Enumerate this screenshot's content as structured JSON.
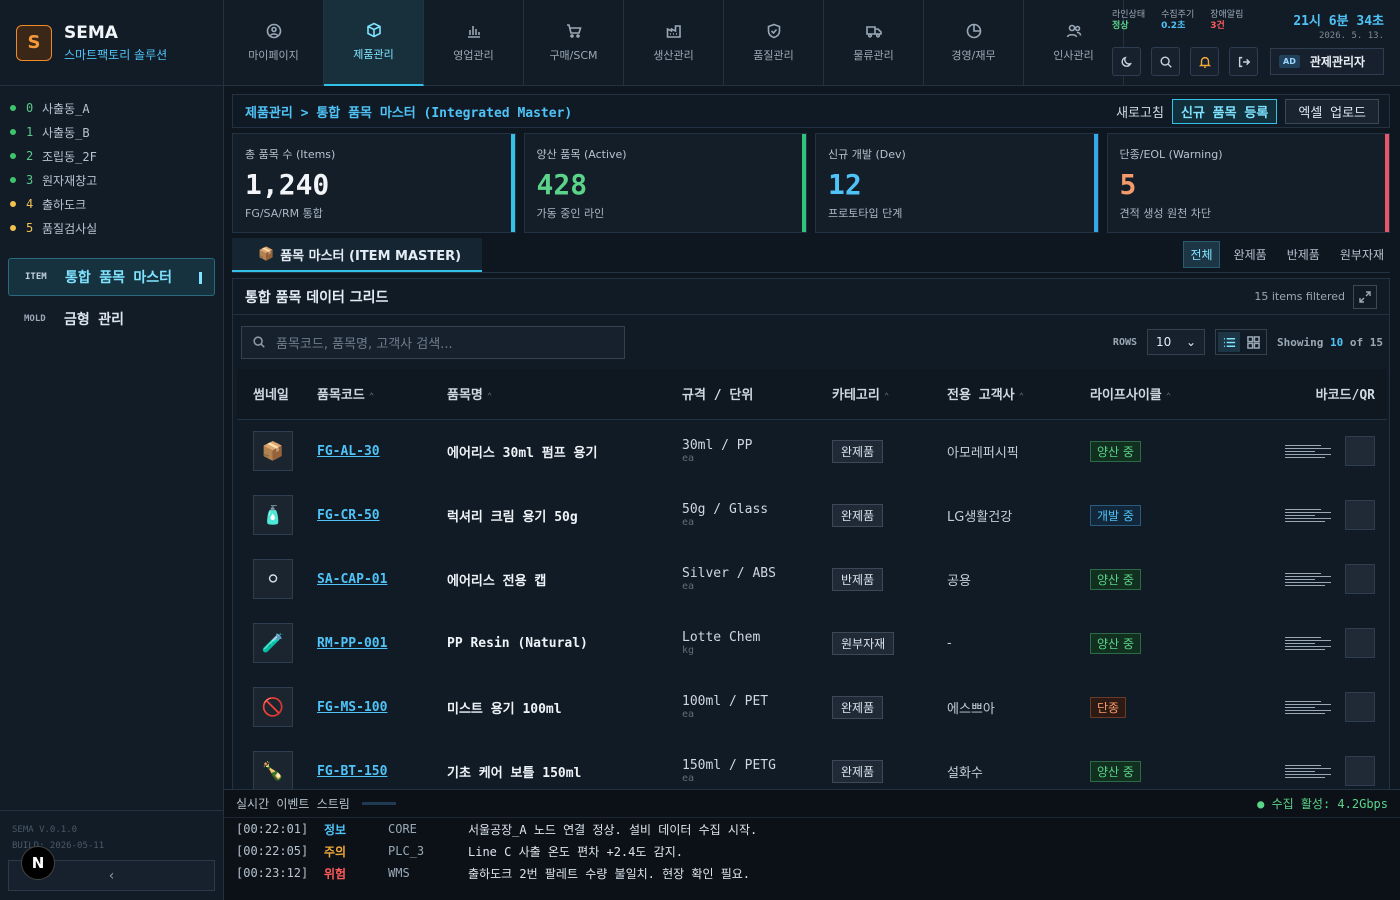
{
  "brand": {
    "logo": "S",
    "name": "SEMA",
    "subtitle": "스마트팩토리 솔루션"
  },
  "zones": [
    {
      "num": "0",
      "label": "사출동_A",
      "color": "#3ec46d",
      "warn": false
    },
    {
      "num": "1",
      "label": "사출동_B",
      "color": "#3ec46d",
      "warn": false
    },
    {
      "num": "2",
      "label": "조립동_2F",
      "color": "#3ec46d",
      "warn": false
    },
    {
      "num": "3",
      "label": "원자재창고",
      "color": "#3ec46d",
      "warn": false
    },
    {
      "num": "4",
      "label": "출하도크",
      "color": "#f2c14e",
      "warn": true
    },
    {
      "num": "5",
      "label": "품질검사실",
      "color": "#f2c14e",
      "warn": true
    }
  ],
  "sidenav": [
    {
      "code": "ITEM",
      "label": "통합 품목 마스터",
      "active": true
    },
    {
      "code": "MOLD",
      "label": "금형 관리",
      "active": false
    }
  ],
  "version": {
    "line1": "SEMA V.0.1.0",
    "line2": "BUILD: 2026-05-11"
  },
  "nbadge": "N",
  "collapse": "‹",
  "tabs": [
    {
      "label": "마이페이지",
      "icon": "user-icon"
    },
    {
      "label": "제품관리",
      "icon": "cube-icon",
      "active": true
    },
    {
      "label": "영업관리",
      "icon": "bar-chart-icon"
    },
    {
      "label": "구매/SCM",
      "icon": "cart-icon"
    },
    {
      "label": "생산관리",
      "icon": "factory-icon"
    },
    {
      "label": "품질관리",
      "icon": "shield-icon"
    },
    {
      "label": "물류관리",
      "icon": "truck-icon"
    },
    {
      "label": "경영/재무",
      "icon": "pie-icon"
    },
    {
      "label": "인사관리",
      "icon": "people-icon"
    }
  ],
  "status": {
    "line_label": "라인상태",
    "line_value": "정상",
    "line_color": "#5bd48a",
    "cycle_label": "수집주기",
    "cycle_value": "0.2초",
    "cycle_color": "#4fc3f7",
    "alarm_label": "장애알림",
    "alarm_value": "3건",
    "alarm_color": "#ff5a5a"
  },
  "clock": {
    "time": "21시 6분 34초",
    "date": "2026. 5. 13."
  },
  "user": {
    "badge": "AD",
    "name": "관제관리자"
  },
  "breadcrumb": "제품관리 > 통합 품목 마스터 (Integrated Master)",
  "actions": {
    "refresh": "새로고침",
    "new": "신규 품목 등록",
    "excel": "엑셀 업로드"
  },
  "kpis": [
    {
      "label": "총 품목 수 (Items)",
      "value": "1,240",
      "sub": "FG/SA/RM 통합",
      "color": "#f2f5f8",
      "edge": "#33c1e8"
    },
    {
      "label": "양산 품목 (Active)",
      "value": "428",
      "sub": "가동 중인 라인",
      "color": "#5bd48a",
      "edge": "#2fc47a"
    },
    {
      "label": "신규 개발 (Dev)",
      "value": "12",
      "sub": "프로토타입 단계",
      "color": "#4fc3f7",
      "edge": "#33a9e8"
    },
    {
      "label": "단종/EOL (Warning)",
      "value": "5",
      "sub": "견적 생성 원천 차단",
      "color": "#f59a6a",
      "edge": "#e8566a"
    }
  ],
  "section_tab": "품목 마스터 (ITEM MASTER)",
  "filters": [
    {
      "label": "전체",
      "active": true
    },
    {
      "label": "완제품"
    },
    {
      "label": "반제품"
    },
    {
      "label": "원부자재"
    }
  ],
  "grid": {
    "title": "통합 품목 데이터 그리드",
    "filtered": "15 items filtered",
    "search_placeholder": "품목코드, 품목명, 고객사 검색...",
    "rows_label": "ROWS",
    "rows_value": "10",
    "showing_prefix": "Showing",
    "showing_count": "10",
    "showing_mid": "of",
    "showing_total": "15",
    "columns": [
      "썸네일",
      "품목코드",
      "품목명",
      "규격 / 단위",
      "카테고리",
      "전용 고객사",
      "라이프사이클",
      "바코드/QR"
    ],
    "rows": [
      {
        "thumb": "📦",
        "code": "FG-AL-30",
        "name": "에어리스 30ml 펌프 용기",
        "spec": "30ml / PP",
        "unit": "ea",
        "category": "완제품",
        "customer": "아모레퍼시픽",
        "life": "양산 중",
        "life_type": "mass"
      },
      {
        "thumb": "🧴",
        "code": "FG-CR-50",
        "name": "럭셔리 크림 용기 50g",
        "spec": "50g / Glass",
        "unit": "ea",
        "category": "완제품",
        "customer": "LG생활건강",
        "life": "개발 중",
        "life_type": "dev"
      },
      {
        "thumb": "⚪",
        "code": "SA-CAP-01",
        "name": "에어리스 전용 캡",
        "spec": "Silver / ABS",
        "unit": "ea",
        "category": "반제품",
        "customer": "공용",
        "life": "양산 중",
        "life_type": "mass"
      },
      {
        "thumb": "🧪",
        "code": "RM-PP-001",
        "name": "PP Resin (Natural)",
        "spec": "Lotte Chem",
        "unit": "kg",
        "category": "원부자재",
        "customer": "-",
        "life": "양산 중",
        "life_type": "mass"
      },
      {
        "thumb": "🚫",
        "code": "FG-MS-100",
        "name": "미스트 용기 100ml",
        "spec": "100ml / PET",
        "unit": "ea",
        "category": "완제품",
        "customer": "에스쁘아",
        "life": "단종",
        "life_type": "eol"
      },
      {
        "thumb": "🍾",
        "code": "FG-BT-150",
        "name": "기초 케어 보틀 150ml",
        "spec": "150ml / PETG",
        "unit": "ea",
        "category": "완제품",
        "customer": "설화수",
        "life": "양산 중",
        "life_type": "mass"
      }
    ]
  },
  "events": {
    "title": "실시간 이벤트 스트림",
    "live": "● 수집 활성: 4.2Gbps",
    "rows": [
      {
        "ts": "[00:22:01]",
        "level": "정보",
        "color": "#4fc3f7",
        "src": "CORE",
        "msg": "서울공장_A 노드 연결 정상. 설비 데이터 수집 시작."
      },
      {
        "ts": "[00:22:05]",
        "level": "주의",
        "color": "#f2a93b",
        "src": "PLC_3",
        "msg": "Line C 사출 온도 편차 +2.4도 감지."
      },
      {
        "ts": "[00:23:12]",
        "level": "위험",
        "color": "#ff5a5a",
        "src": "WMS",
        "msg": "출하도크 2번 팔레트 수량 불일치. 현장 확인 필요."
      }
    ]
  }
}
